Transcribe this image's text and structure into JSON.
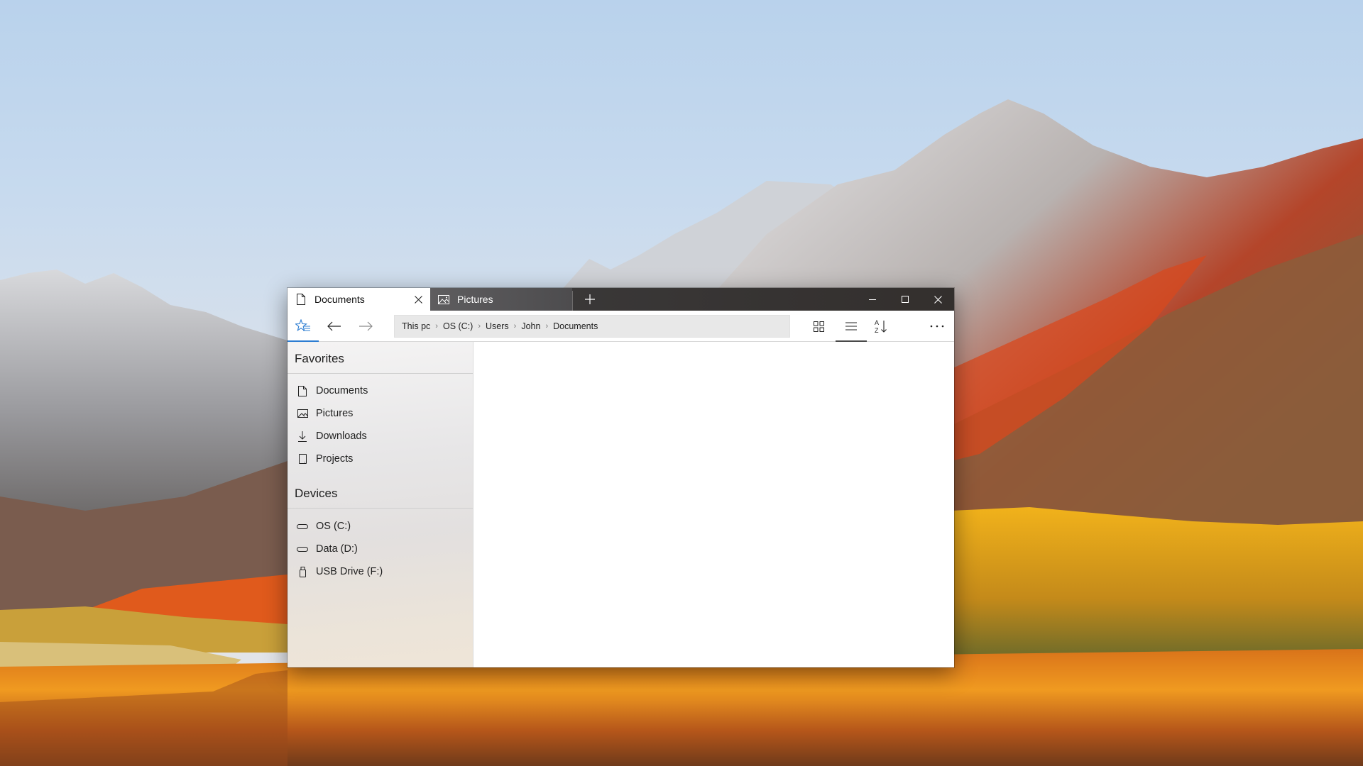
{
  "window": {
    "tabs": [
      {
        "label": "Documents",
        "icon": "document-icon",
        "active": true
      },
      {
        "label": "Pictures",
        "icon": "picture-icon",
        "active": false
      }
    ],
    "new_tab_symbol": "+",
    "controls": {
      "minimize": "minimize-icon",
      "maximize": "maximize-icon",
      "close": "close-icon"
    }
  },
  "toolbar": {
    "favorites_icon": "star-list-icon",
    "back_icon": "arrow-left-icon",
    "forward_icon": "arrow-right-icon",
    "breadcrumb": [
      "This pc",
      "OS (C:)",
      "Users",
      "John",
      "Documents"
    ],
    "breadcrumb_separator": "›",
    "view_grid_icon": "grid-view-icon",
    "view_list_icon": "list-view-icon",
    "sort_icon": "sort-az-icon",
    "more_icon": "more-icon",
    "active_view": "list",
    "accent_color": "#2d7dd2"
  },
  "sidebar": {
    "sections": [
      {
        "title": "Favorites",
        "items": [
          {
            "label": "Documents",
            "icon": "document-icon"
          },
          {
            "label": "Pictures",
            "icon": "picture-icon"
          },
          {
            "label": "Downloads",
            "icon": "download-icon"
          },
          {
            "label": "Projects",
            "icon": "tablet-icon"
          }
        ]
      },
      {
        "title": "Devices",
        "items": [
          {
            "label": "OS (C:)",
            "icon": "drive-icon"
          },
          {
            "label": "Data (D:)",
            "icon": "drive-icon"
          },
          {
            "label": "USB Drive (F:)",
            "icon": "usb-drive-icon"
          }
        ]
      }
    ]
  },
  "content": {
    "items": []
  }
}
